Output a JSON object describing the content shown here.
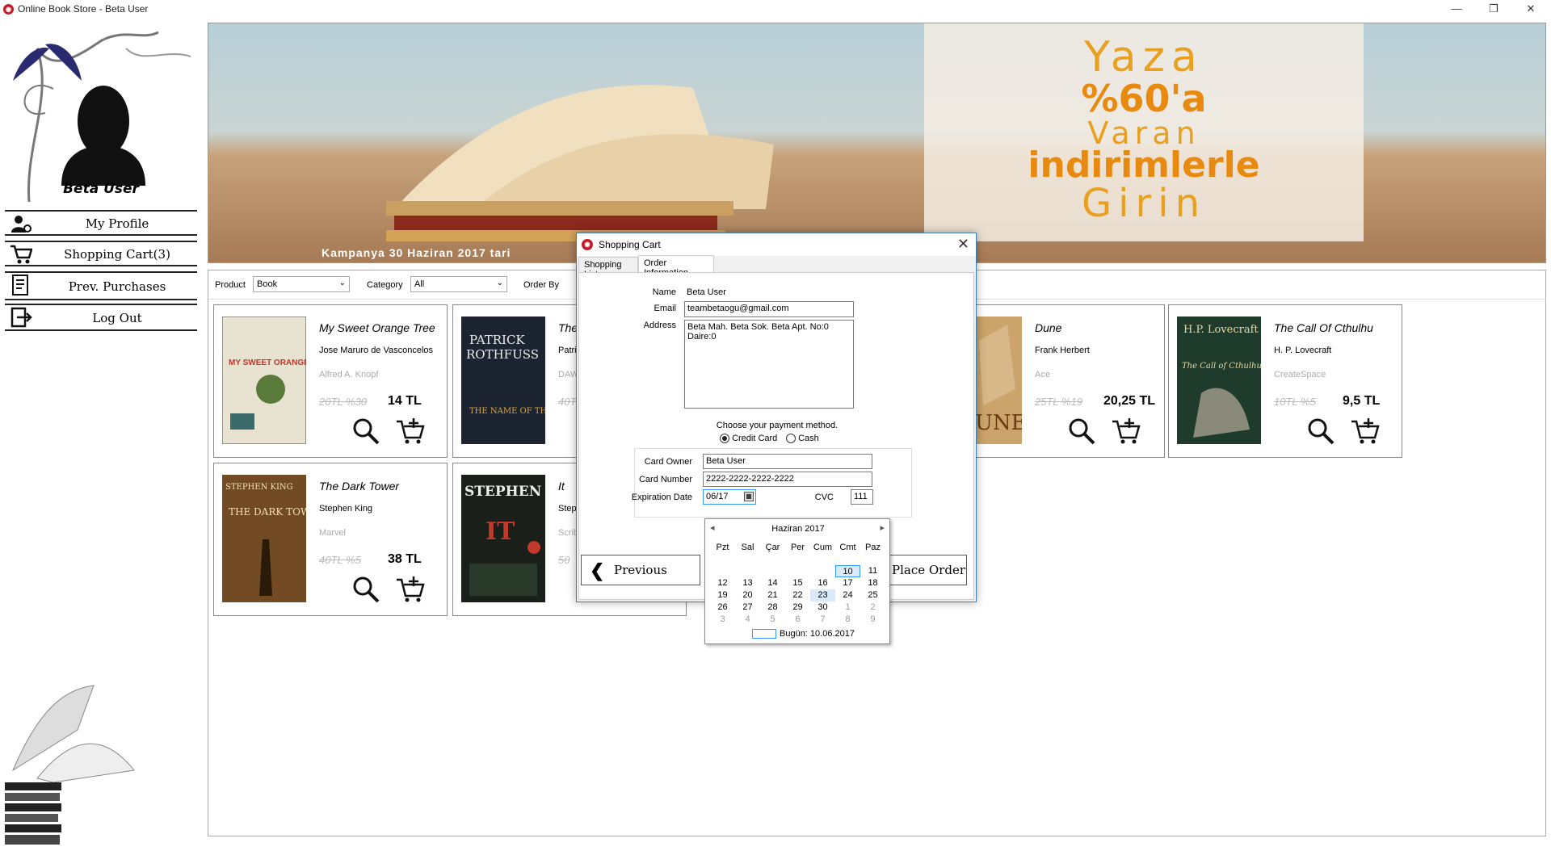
{
  "window": {
    "title": "Online Book Store - Beta User",
    "controls": [
      "—",
      "❐",
      "✕"
    ]
  },
  "sidebar": {
    "user_name": "Beta User",
    "items": [
      {
        "label": "My Profile",
        "icon": "user-gear-icon"
      },
      {
        "label": "Shopping Cart(3)",
        "icon": "cart-icon"
      },
      {
        "label": "Prev. Purchases",
        "icon": "document-list-icon"
      },
      {
        "label": "Log Out",
        "icon": "logout-icon"
      }
    ]
  },
  "banner": {
    "line1": "Yaza",
    "line2": "%60'a",
    "line3": "Varan",
    "line4": "indirimlerle",
    "line5": "Girin",
    "caption": "Kampanya 30 Haziran 2017 tari"
  },
  "filters": {
    "product_label": "Product",
    "product_value": "Book",
    "category_label": "Category",
    "category_value": "All",
    "orderby_label": "Order By"
  },
  "books": [
    {
      "title": "My Sweet Orange Tree",
      "author": "Jose Maruro de Vasconcelos",
      "publisher": "Alfred A. Knopf",
      "old_price": "20TL %30",
      "price": "14 TL",
      "cover_color": "#e8e2d0"
    },
    {
      "title": "The",
      "author": "Patri",
      "publisher": "DAW",
      "old_price": "40T",
      "price": "",
      "cover_color": "#1b2430"
    },
    {
      "title": "Dune",
      "author": "Frank Herbert",
      "publisher": "Ace",
      "old_price": "25TL %19",
      "price": "20,25 TL",
      "cover_color": "#caa46a"
    },
    {
      "title": "The Call Of Cthulhu",
      "author": "H. P. Lovecraft",
      "publisher": "CreateSpace",
      "old_price": "10TL %5",
      "price": "9,5 TL",
      "cover_color": "#1e3b2c"
    },
    {
      "title": "The Dark Tower",
      "author": "Stephen King",
      "publisher": "Marvel",
      "old_price": "40TL %5",
      "price": "38 TL",
      "cover_color": "#5a3a1c"
    },
    {
      "title": "It",
      "author": "Step",
      "publisher": "Scrib",
      "old_price": "50",
      "price": "",
      "cover_color": "#1a1f1a"
    }
  ],
  "cover_texts": {
    "b1": "MY SWEET ORANGE TREE",
    "b2a": "PATRICK",
    "b2b": "ROTHFUSS",
    "b2c": "THE NAME OF THE WIND",
    "b3": "UNE",
    "b4a": "H.P. Lovecraft",
    "b4b": "The Call of Cthulhu",
    "b5a": "STEPHEN KING",
    "b5b": "THE DARK TOWER",
    "b6a": "STEPHEN KING",
    "b6b": "IT"
  },
  "dialog": {
    "title": "Shopping Cart",
    "tabs": [
      "Shopping List",
      "Order Information"
    ],
    "name_label": "Name",
    "name_value": "Beta User",
    "email_label": "Email",
    "email_value": "teambetaogu@gmail.com",
    "address_label": "Address",
    "address_line1": "Beta Mah. Beta Sok. Beta Apt. No:0",
    "address_line2": "Daire:0",
    "payment_prompt": "Choose your payment method.",
    "payment_options": [
      "Credit Card",
      "Cash"
    ],
    "payment_selected": "Credit Card",
    "card_owner_label": "Card Owner",
    "card_owner_value": "Beta User",
    "card_number_label": "Card Number",
    "card_number_value": "2222-2222-2222-2222",
    "exp_label": "Expiration Date",
    "exp_value": "06/17",
    "cvc_label": "CVC",
    "cvc_value": "111",
    "prev_button": "Previous",
    "place_button": "Place Order"
  },
  "calendar": {
    "month": "Haziran 2017",
    "days": [
      "Pzt",
      "Sal",
      "Çar",
      "Per",
      "Cum",
      "Cmt",
      "Paz"
    ],
    "weeks": [
      [
        "",
        "",
        "",
        "",
        "",
        "10",
        "11"
      ],
      [
        "12",
        "13",
        "14",
        "15",
        "16",
        "17",
        "18"
      ],
      [
        "19",
        "20",
        "21",
        "22",
        "23",
        "24",
        "25"
      ],
      [
        "26",
        "27",
        "28",
        "29",
        "30",
        "1",
        "2"
      ],
      [
        "3",
        "4",
        "5",
        "6",
        "7",
        "8",
        "9"
      ]
    ],
    "selected": "10",
    "today": "Bugün: 10.06.2017"
  }
}
